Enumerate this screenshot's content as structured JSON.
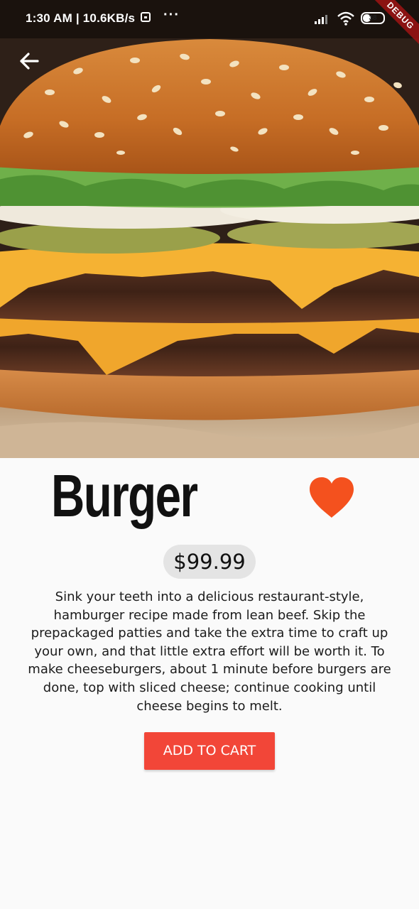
{
  "status_bar": {
    "time_speed": "1:30 AM | 10.6KB/s",
    "more": "···",
    "battery_percent": "38",
    "battery_level": 0.38
  },
  "debug_banner": "DEBUG",
  "product": {
    "title": "Burger",
    "price": "$99.99",
    "description": "Sink your teeth into a delicious restaurant-style, hamburger recipe made from lean beef. Skip the prepackaged patties and take the extra time to craft up your own, and that little extra effort will be worth it. To make cheeseburgers, about 1 minute before burgers are done, top with sliced cheese; continue cooking until cheese begins to melt.",
    "add_to_cart_label": "ADD TO CART",
    "favorited": true
  },
  "colors": {
    "heart": "#f4511e",
    "button": "#f24638",
    "price_pill": "#e4e4e4",
    "background": "#fafafa"
  },
  "icons": {
    "back": "arrow-back-icon",
    "favorite": "heart-icon",
    "signal": "signal-icon",
    "wifi": "wifi-icon",
    "battery": "battery-icon",
    "download": "download-icon"
  }
}
